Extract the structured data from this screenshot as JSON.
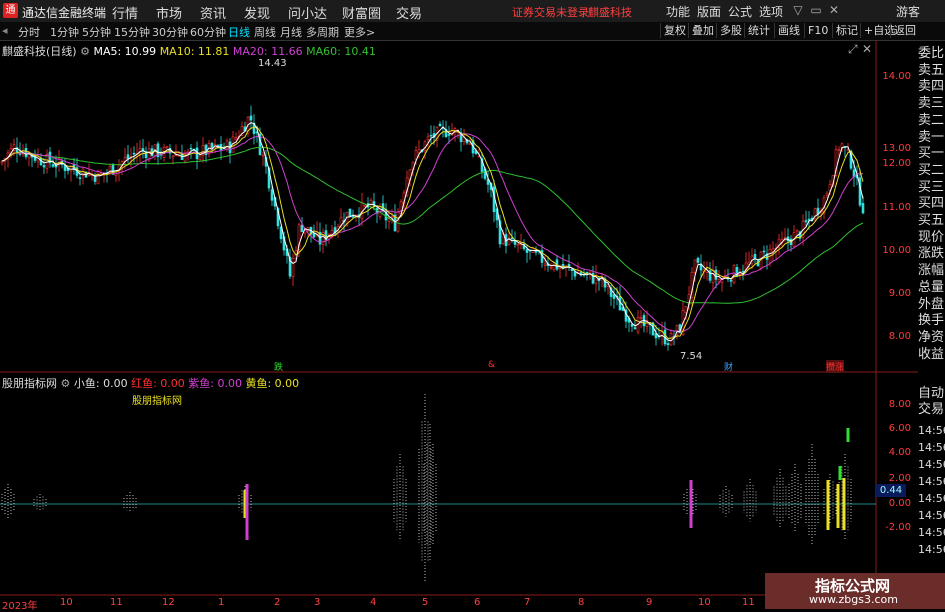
{
  "app": {
    "logo": "通",
    "title": "通达信金融终端"
  },
  "menu": [
    "行情",
    "市场",
    "资讯",
    "发现",
    "问小达",
    "财富圈",
    "交易"
  ],
  "status": {
    "trade_login": "证券交易未登录",
    "stock_name": "麒盛科技"
  },
  "top_right": [
    "功能",
    "版面",
    "公式",
    "选项",
    "游客"
  ],
  "periods": [
    "分时",
    "1分钟",
    "5分钟",
    "15分钟",
    "30分钟",
    "60分钟",
    "日线",
    "周线",
    "月线",
    "多周期",
    "更多>"
  ],
  "active_period": "日线",
  "right_tools": [
    "复权",
    "叠加",
    "多股",
    "统计",
    "画线",
    "F10",
    "标记",
    "+自选",
    "返回"
  ],
  "stock": {
    "title": "麒盛科技(日线)",
    "ma5": "MA5: 10.99",
    "ma10": "MA10: 11.81",
    "ma20": "MA20: 11.66",
    "ma60": "MA60: 10.41",
    "high_label": "14.43",
    "low_label": "7.54"
  },
  "indicator": {
    "name": "股朋指标网",
    "small": "小鱼: 0.00",
    "red": "红鱼: 0.00",
    "purple": "紫鱼: 0.00",
    "yellow": "黄鱼: 0.00",
    "label": "股朋指标网",
    "current": "0.44"
  },
  "price_axis": [
    "14.00",
    "13.00",
    "12.00",
    "11.00",
    "10.00",
    "9.00",
    "8.00"
  ],
  "ind_axis": [
    "8.00",
    "6.00",
    "4.00",
    "2.00",
    "0.00",
    "-2.00"
  ],
  "time_axis": [
    "14:56",
    "14:56",
    "14:56",
    "14:56",
    "14:56",
    "14:56",
    "14:56",
    "14:56"
  ],
  "side_quote": [
    "委比",
    "卖五",
    "卖四",
    "卖三",
    "卖二",
    "卖一",
    "买一",
    "买二",
    "买三",
    "买四",
    "买五",
    "现价",
    "涨跌",
    "涨幅",
    "总量",
    "外盘",
    "换手",
    "净资",
    "收益"
  ],
  "side_trade": [
    "自动",
    "交易"
  ],
  "dates": [
    "2023年",
    "10",
    "11",
    "12",
    "1",
    "2",
    "3",
    "4",
    "5",
    "6",
    "7",
    "8",
    "9",
    "10",
    "11"
  ],
  "events": [
    "跌",
    "&",
    "财",
    "攒涨"
  ],
  "watermark": {
    "line1": "指标公式网",
    "line2": "www.zbgs3.com"
  },
  "colors": {
    "ma5": "#ffffff",
    "ma10": "#e8e020",
    "ma20": "#d040d0",
    "ma60": "#30c030",
    "up": "#ff3030",
    "down": "#30e0e0"
  }
}
